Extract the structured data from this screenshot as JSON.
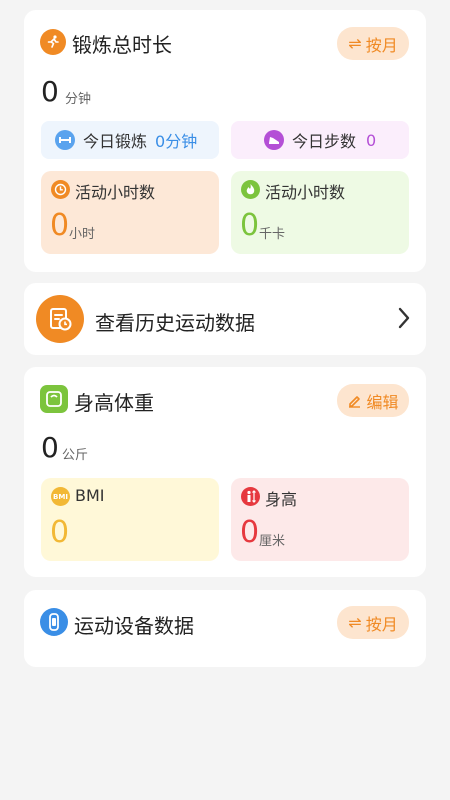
{
  "colors": {
    "orange": "#f08a24",
    "blue": "#3a8ee6",
    "purple": "#b44fd6",
    "green": "#7cc43d",
    "red": "#e6393f",
    "yellow": "#f2b835"
  },
  "exercise": {
    "title": "锻炼总时长",
    "toggle_label": "按月",
    "total_value": "0",
    "total_unit": "分钟",
    "today_exercise_label": "今日锻炼",
    "today_exercise_value": "0分钟",
    "today_steps_label": "今日步数",
    "today_steps_value": "0",
    "tile1_label": "活动小时数",
    "tile1_value": "0",
    "tile1_unit": "小时",
    "tile2_label": "活动小时数",
    "tile2_value": "0",
    "tile2_unit": "千卡"
  },
  "history": {
    "label": "查看历史运动数据"
  },
  "body": {
    "title": "身高体重",
    "edit_label": "编辑",
    "weight_value": "0",
    "weight_unit": "公斤",
    "bmi_label": "BMI",
    "bmi_icon_text": "BMI",
    "bmi_value": "0",
    "height_label": "身高",
    "height_value": "0",
    "height_unit": "厘米"
  },
  "device": {
    "title": "运动设备数据",
    "toggle_label": "按月"
  },
  "icons": {
    "swap": "⇌",
    "chevron": "›"
  }
}
